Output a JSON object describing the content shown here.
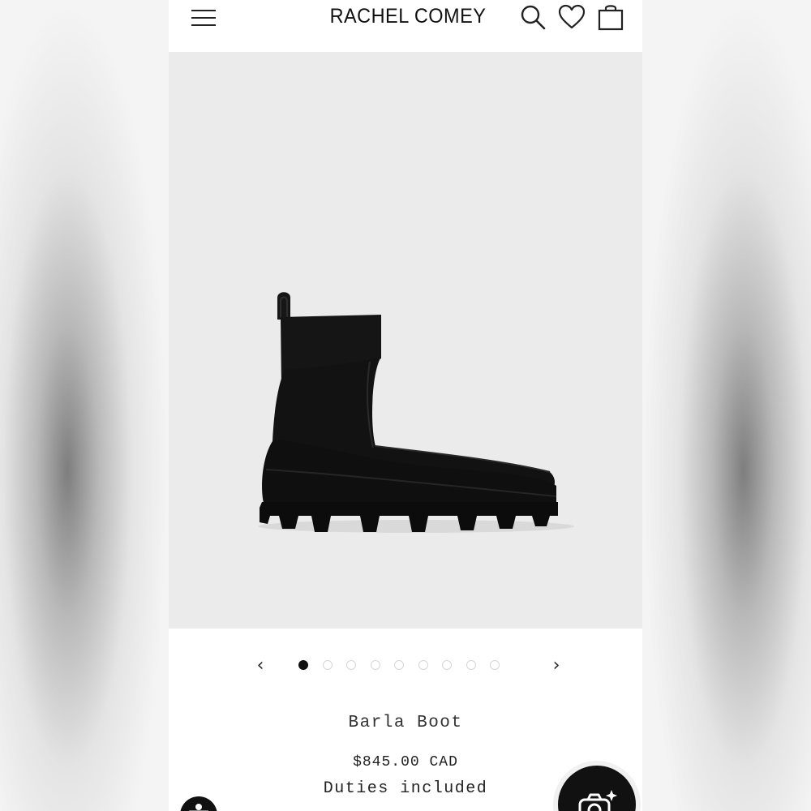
{
  "header": {
    "brand": "RACHEL COMEY"
  },
  "icons": {
    "menu": "hamburger-menu-icon",
    "search": "search-icon",
    "wishlist": "heart-icon",
    "cart": "shopping-bag-icon",
    "prev": "chevron-left-icon",
    "next": "chevron-right-icon",
    "accessibility": "accessibility-icon",
    "camera": "camera-sparkle-icon"
  },
  "carousel": {
    "prev_glyph": "‹",
    "next_glyph": "›",
    "total_slides": 9,
    "active_index": 0
  },
  "product": {
    "name": "Barla Boot",
    "price": "$845.00 CAD",
    "duties_note": "Duties included"
  },
  "colors": {
    "hero_background": "#ebebeb",
    "text": "#222222",
    "button_dark": "#111111"
  }
}
